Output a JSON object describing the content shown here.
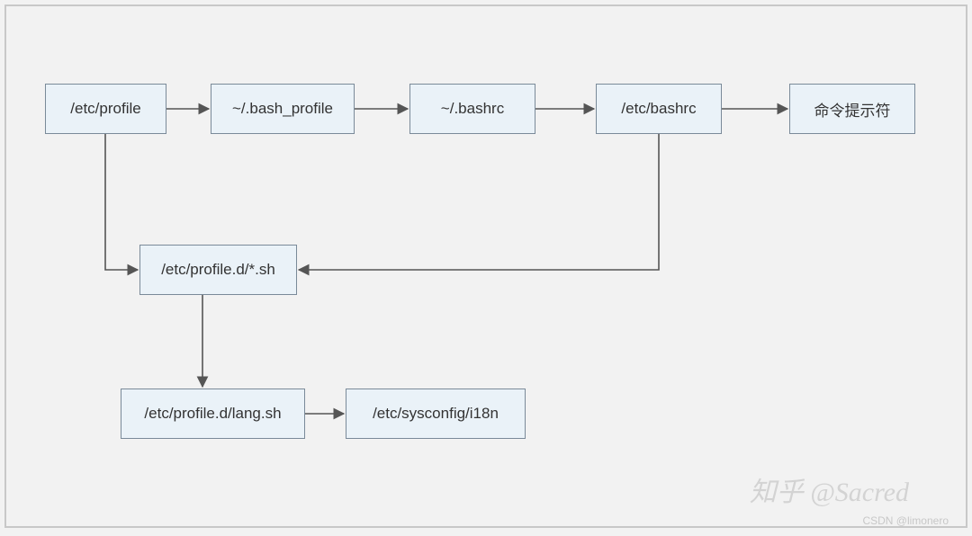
{
  "nodes": {
    "etc_profile": "/etc/profile",
    "bash_profile": "~/.bash_profile",
    "bashrc_home": "~/.bashrc",
    "etc_bashrc": "/etc/bashrc",
    "prompt": "命令提示符",
    "profile_d_sh": "/etc/profile.d/*.sh",
    "profile_d_lang": "/etc/profile.d/lang.sh",
    "sysconfig_i18n": "/etc/sysconfig/i18n"
  },
  "watermarks": {
    "zhihu": "知乎 @Sacred",
    "csdn": "CSDN @limonero"
  }
}
